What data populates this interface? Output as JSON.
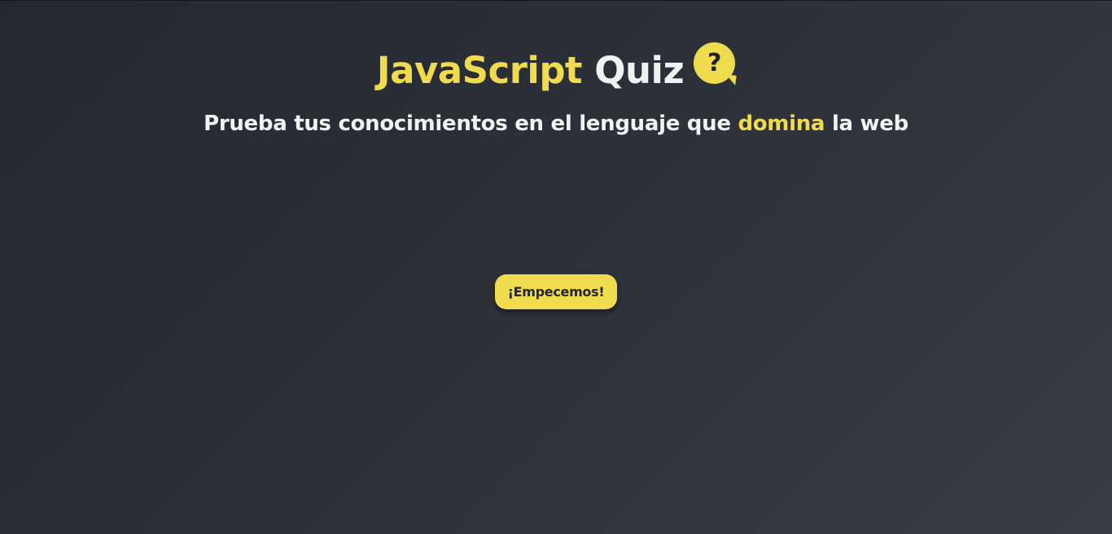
{
  "header": {
    "title_highlight": "JavaScript",
    "title_rest": "Quiz",
    "icon_glyph": "?",
    "icon": "question-bubble-icon",
    "subtitle_before": "Prueba tus conocimientos en el lenguaje que",
    "subtitle_highlight": "domina",
    "subtitle_after": "la web"
  },
  "actions": {
    "start_label": "¡Empecemos!"
  },
  "colors": {
    "accent": "#f0db4f",
    "text": "#f2f2f2",
    "background": "#2d3139"
  }
}
